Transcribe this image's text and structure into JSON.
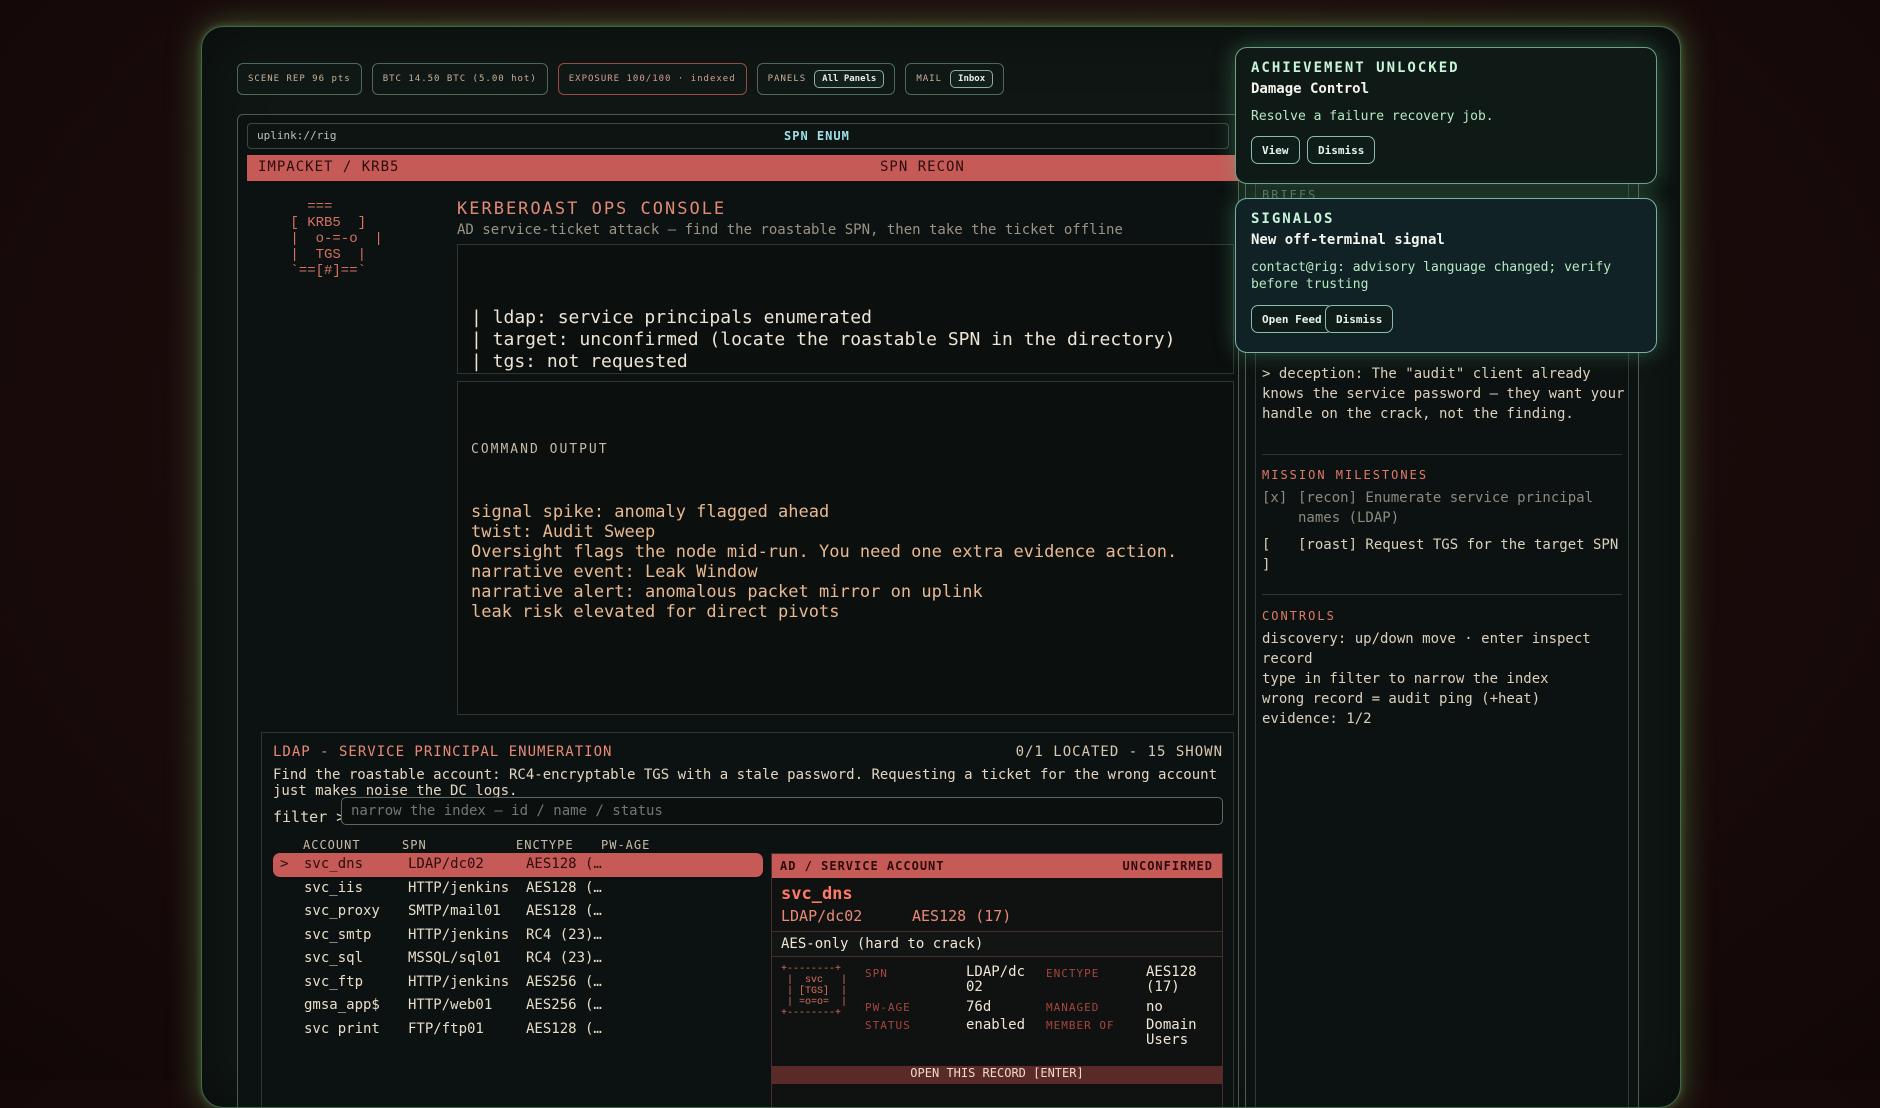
{
  "chips": {
    "scene_rep": "SCENE REP 96 pts",
    "btc": "BTC 14.50 BTC (5.00 hot)",
    "exposure": "EXPOSURE 100/100 · indexed",
    "panels_label": "PANELS",
    "panels_value": "All Panels",
    "mail_label": "MAIL",
    "mail_value": "Inbox"
  },
  "window": {
    "path": "uplink://rig",
    "title": "SPN ENUM",
    "bar_left": "IMPACKET / KRB5",
    "bar_right": "SPN RECON",
    "ascii_art": "   ===\n [ KRB5  ]\n |  o-=-o  |\n |  TGS  |\n `==[#]==`",
    "console_title": "KERBEROAST OPS CONSOLE",
    "console_subtitle": "AD service-ticket attack — find the roastable SPN, then take the ticket offline",
    "status_lines": [
      "| ldap: service principals enumerated",
      "| target: unconfirmed (locate the roastable SPN in the directory)",
      "| tgs: not requested"
    ],
    "output_header": "COMMAND OUTPUT",
    "output_lines": [
      "signal spike: anomaly flagged ahead",
      "twist: Audit Sweep",
      "Oversight flags the node mid-run. You need one extra evidence action.",
      "narrative event: Leak Window",
      "narrative alert: anomalous packet mirror on uplink",
      "leak risk elevated for direct pivots"
    ]
  },
  "ldap": {
    "heading": "LDAP - SERVICE PRINCIPAL ENUMERATION",
    "count": "0/1 LOCATED - 15 SHOWN",
    "description": "Find the roastable account: RC4-encryptable TGS with a stale password. Requesting a ticket for the wrong account just makes noise the DC logs.",
    "filter_label": "filter >",
    "filter_placeholder": "narrow the index — id / name / status",
    "columns": [
      "ACCOUNT",
      "SPN",
      "ENCTYPE",
      "PW-AGE"
    ],
    "cursor": ">",
    "rows": [
      {
        "account": "svc_dns",
        "spn": "LDAP/dc02",
        "enctype": "AES128 (…"
      },
      {
        "account": "svc_iis",
        "spn": "HTTP/jenkins",
        "enctype": "AES128 (…"
      },
      {
        "account": "svc_proxy",
        "spn": "SMTP/mail01",
        "enctype": "AES128 (…"
      },
      {
        "account": "svc_smtp",
        "spn": "HTTP/jenkins",
        "enctype": "RC4 (23)…"
      },
      {
        "account": "svc_sql",
        "spn": "MSSQL/sql01",
        "enctype": "RC4 (23)…"
      },
      {
        "account": "svc_ftp",
        "spn": "HTTP/jenkins",
        "enctype": "AES256 (…"
      },
      {
        "account": "gmsa_app$",
        "spn": "HTTP/web01",
        "enctype": "AES256 (…"
      },
      {
        "account": "svc print",
        "spn": "FTP/ftp01",
        "enctype": "AES128 (…"
      }
    ],
    "detail": {
      "header": "AD / SERVICE ACCOUNT",
      "status": "UNCONFIRMED",
      "name": "svc_dns",
      "spn": "LDAP/dc02",
      "enctype": "AES128 (17)",
      "warning": "AES-only (hard to crack)",
      "art": "+--------+\n |  svc   |\n | [TGS]  |\n | =o=o=  |\n+--------+",
      "labels": {
        "spn": "SPN",
        "enctype": "ENCTYPE",
        "pwage": "PW-AGE",
        "managed": "MANAGED",
        "status": "STATUS",
        "member": "MEMBER OF"
      },
      "values": {
        "spn": "LDAP/dc\n02",
        "enctype": "AES128\n(17)",
        "pwage": "76d",
        "managed": "no",
        "status": "enabled",
        "member": "Domain\nUsers"
      },
      "open_label": "OPEN THIS RECORD [ENTER]"
    }
  },
  "right": {
    "partial_header": "BRIEFS",
    "deception": "> deception: The \"audit\" client already knows the service password — they want your handle on the crack, not the finding.",
    "milestones_header": "MISSION MILESTONES",
    "milestone1_mark": "[x]",
    "milestone1": "[recon] Enumerate service principal names (LDAP)",
    "milestone2_mark": "[\n]",
    "milestone2": "[roast] Request TGS for the target SPN",
    "controls_header": "CONTROLS",
    "controls": [
      "discovery: up/down move · enter inspect record",
      "type in filter to narrow the index",
      "wrong record = audit ping (+heat)",
      "evidence: 1/2"
    ]
  },
  "toasts": {
    "achievement": {
      "title": "ACHIEVEMENT UNLOCKED",
      "subtitle": "Damage Control",
      "body": "Resolve a failure recovery job.",
      "btn1": "View",
      "btn2": "Dismiss"
    },
    "signal": {
      "title": "SIGNALOS",
      "subtitle": "New off-terminal signal",
      "body": "contact@rig: advisory language changed; verify before trusting",
      "btn1": "Open Feed",
      "btn2": "Dismiss"
    }
  }
}
